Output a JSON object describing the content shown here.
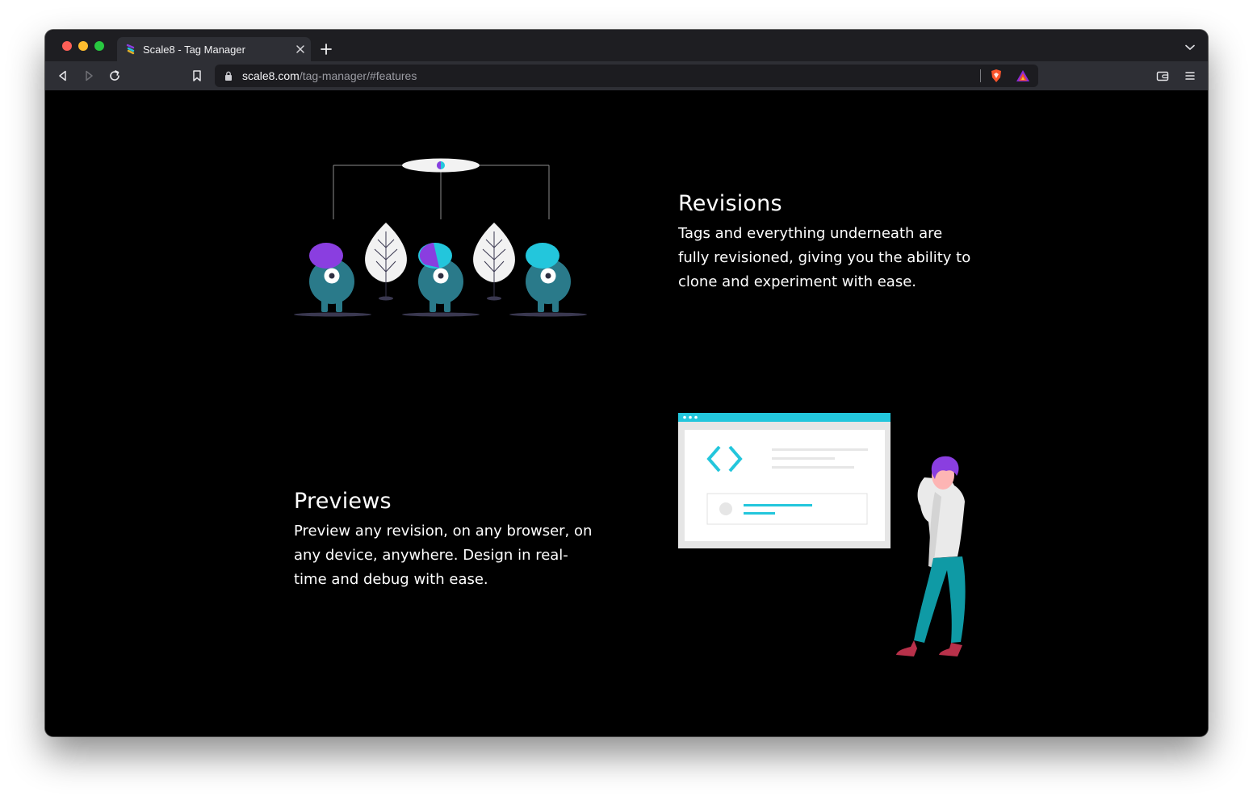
{
  "browser": {
    "tab": {
      "title": "Scale8 - Tag Manager"
    },
    "url": {
      "host": "scale8.com",
      "path": "/tag-manager/#features"
    },
    "icons": {
      "back": "back-arrow-icon",
      "forward": "forward-arrow-icon",
      "reload": "reload-icon",
      "bookmark": "bookmark-icon",
      "lock": "lock-icon",
      "shields": "brave-shields-icon",
      "rewards": "brave-rewards-icon",
      "wallet": "wallet-icon",
      "menu": "hamburger-menu-icon"
    }
  },
  "features": [
    {
      "title": "Revisions",
      "text": "Tags and everything underneath are fully revisioned, giving you the ability to clone and experiment with ease."
    },
    {
      "title": "Previews",
      "text": "Preview any revision, on any browser, on any device, anywhere. Design in real-time and debug with ease."
    }
  ],
  "colors": {
    "background": "#000000",
    "purple": "#8a3ee0",
    "cyan": "#23c6dc",
    "teal": "#2a7a8a",
    "pants": "#0f9aa5",
    "shoes": "#b8314a"
  }
}
